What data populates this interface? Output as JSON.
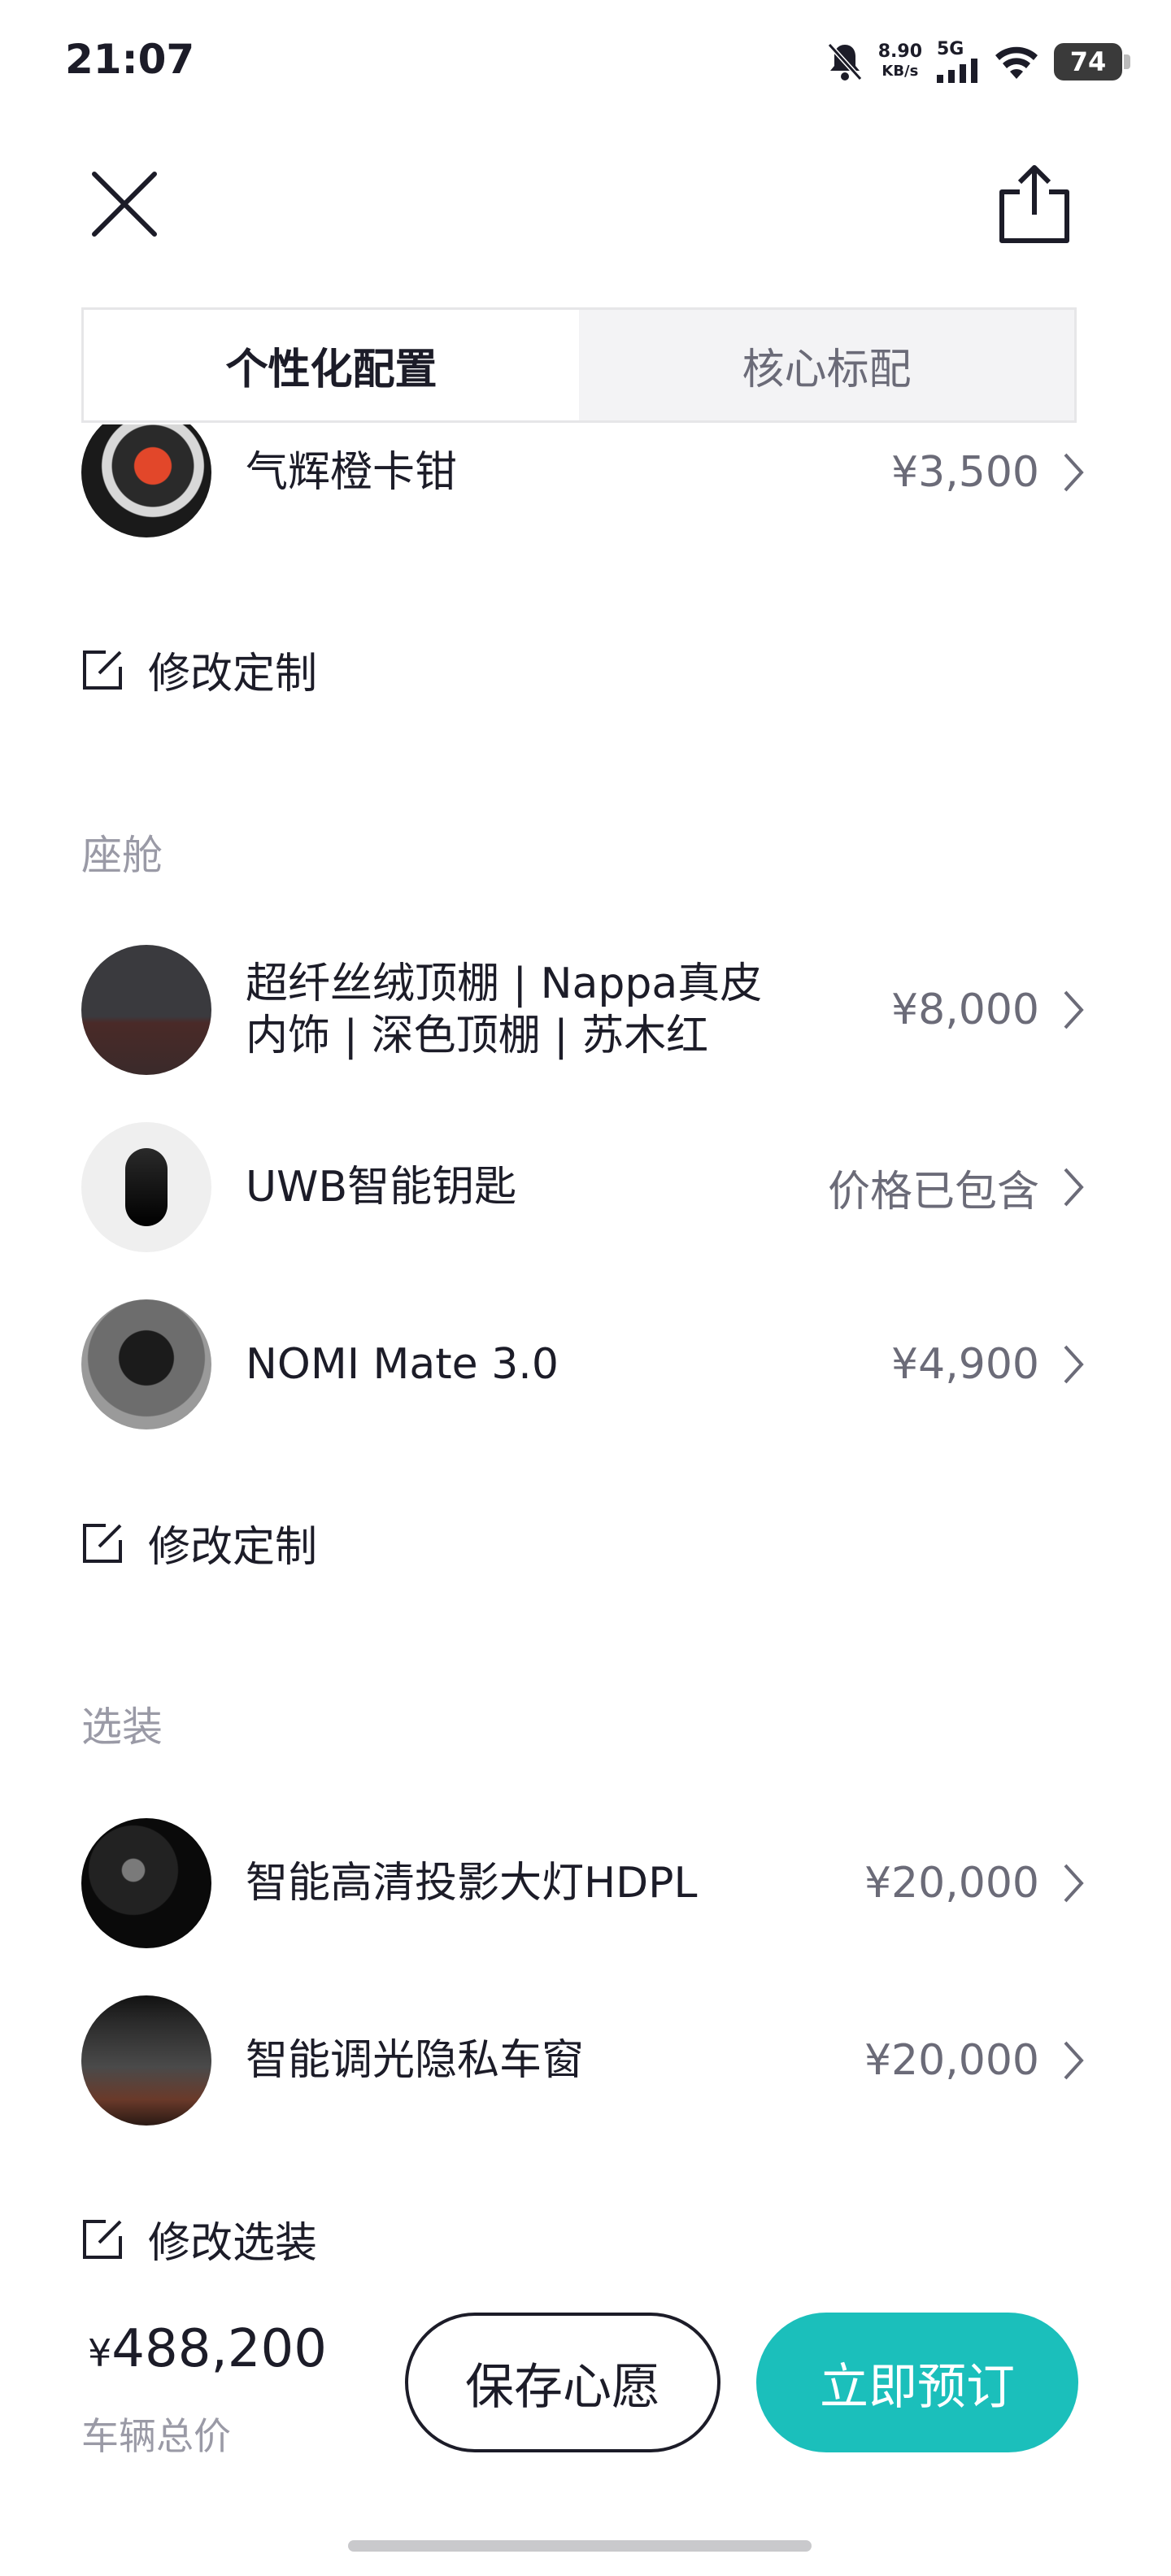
{
  "status_bar": {
    "time": "21:07",
    "net_speed": "8.90",
    "net_unit": "KB/s",
    "signal": "5G",
    "battery": "74"
  },
  "tabs": [
    {
      "label": "个性化配置",
      "active": true
    },
    {
      "label": "核心标配",
      "active": false
    }
  ],
  "top_item": {
    "label": "气辉橙卡钳",
    "price": "¥3,500"
  },
  "edit_custom_1": "修改定制",
  "cabin": {
    "title": "座舱",
    "items": [
      {
        "label_line1": "超纤丝绒顶棚 | Nappa真皮",
        "label_line2": "内饰 | 深色顶棚 | 苏木红",
        "price": "¥8,000"
      },
      {
        "label": "UWB智能钥匙",
        "price": "价格已包含"
      },
      {
        "label": "NOMI Mate 3.0",
        "price": "¥4,900"
      }
    ],
    "edit_label": "修改定制"
  },
  "options": {
    "title": "选装",
    "items": [
      {
        "label": "智能高清投影大灯HDPL",
        "price": "¥20,000"
      },
      {
        "label": "智能调光隐私车窗",
        "price": "¥20,000"
      }
    ],
    "edit_label": "修改选装"
  },
  "footer": {
    "currency": "¥",
    "total": "488,200",
    "total_label": "车辆总价",
    "save_label": "保存心愿",
    "order_label": "立即预订",
    "accent_color": "#1bbfbb"
  }
}
